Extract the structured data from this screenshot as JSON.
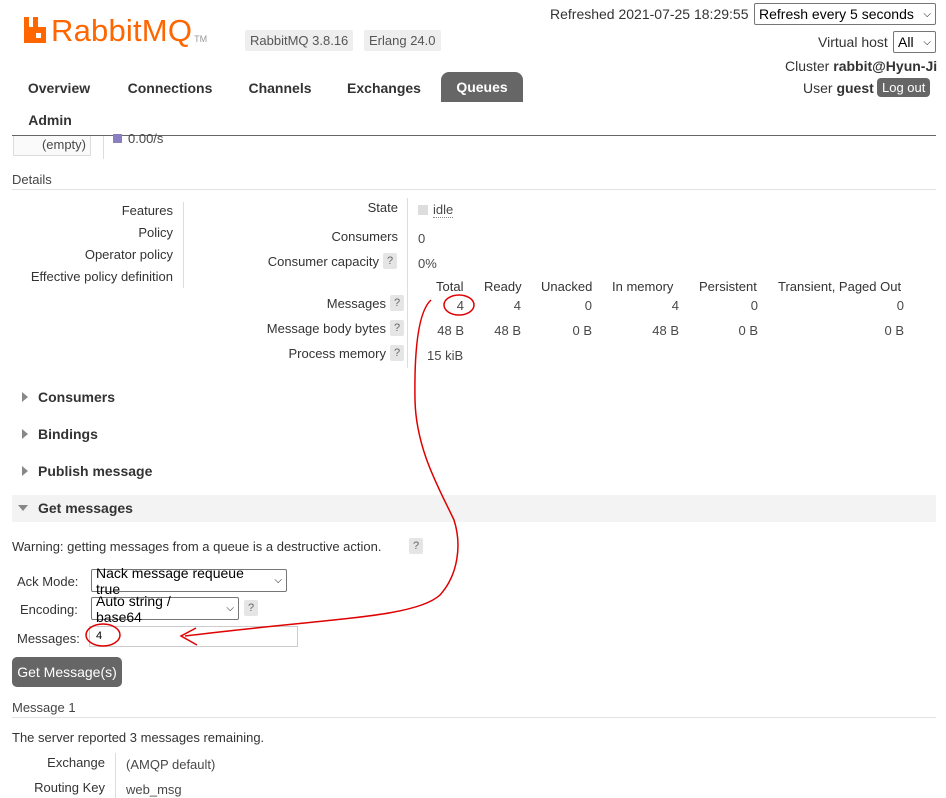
{
  "header": {
    "logo_text": "RabbitMQ",
    "logo_tm": "TM",
    "rabbit_version": "RabbitMQ 3.8.16",
    "erlang_version": "Erlang 24.0",
    "refreshed": "Refreshed 2021-07-25 18:29:55",
    "refresh_select": "Refresh every 5 seconds",
    "vhost_label": "Virtual host",
    "vhost_value": "All",
    "cluster_label": "Cluster",
    "cluster_value": "rabbit@Hyun-Ji",
    "user_label": "User",
    "user_value": "guest",
    "logout": "Log out"
  },
  "tabs": [
    "Overview",
    "Connections",
    "Channels",
    "Exchanges",
    "Queues",
    "Admin"
  ],
  "active_tab": "Queues",
  "rate_strip": {
    "empty_label": "(empty)",
    "rate": "0.00/s"
  },
  "details": {
    "title": "Details",
    "left_labels": [
      "Features",
      "Policy",
      "Operator policy",
      "Effective policy definition"
    ],
    "state_label": "State",
    "state_value": "idle",
    "consumers_label": "Consumers",
    "consumers_value": "0",
    "capacity_label": "Consumer capacity",
    "capacity_value": "0%",
    "columns": [
      "Total",
      "Ready",
      "Unacked",
      "In memory",
      "Persistent",
      "Transient, Paged Out"
    ],
    "rows": [
      {
        "label": "Messages",
        "values": [
          "4",
          "4",
          "0",
          "4",
          "0",
          "0"
        ]
      },
      {
        "label": "Message body bytes",
        "values": [
          "48 B",
          "48 B",
          "0 B",
          "48 B",
          "0 B",
          "0 B"
        ]
      },
      {
        "label": "Process memory",
        "values": [
          "15 kiB"
        ]
      }
    ]
  },
  "sections": {
    "consumers": "Consumers",
    "bindings": "Bindings",
    "publish": "Publish message",
    "get": "Get messages"
  },
  "get_messages": {
    "warning": "Warning: getting messages from a queue is a destructive action.",
    "ack_label": "Ack Mode:",
    "ack_value": "Nack message requeue true",
    "encoding_label": "Encoding:",
    "encoding_value": "Auto string / base64",
    "messages_label": "Messages:",
    "messages_value": "4",
    "button": "Get Message(s)"
  },
  "message_result": {
    "title": "Message 1",
    "remaining": "The server reported 3 messages remaining.",
    "exchange_label": "Exchange",
    "exchange_value": "(AMQP default)",
    "routing_label": "Routing Key",
    "routing_value": "web_msg"
  },
  "help_glyph": "?",
  "colors": {
    "brand": "#ff6600",
    "tab_active": "#666666",
    "annotation": "#e00000",
    "rate_swatch": "#8a7fc0"
  }
}
